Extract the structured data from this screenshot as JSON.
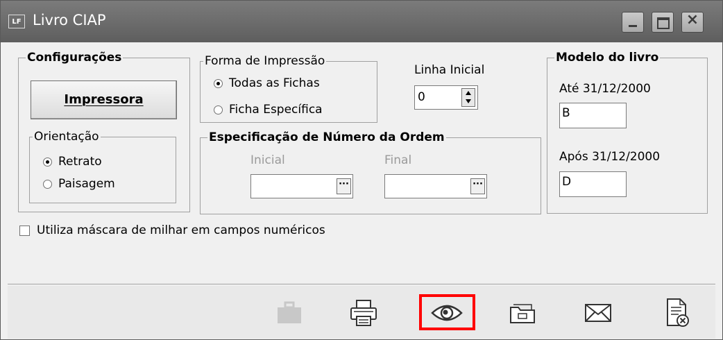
{
  "window": {
    "icon_text": "LF",
    "title": "Livro CIAP"
  },
  "configuracoes": {
    "legend": "Configurações",
    "printer_button": "Impressora",
    "orientacao": {
      "legend": "Orientação",
      "options": [
        "Retrato",
        "Paisagem"
      ],
      "selected": "Retrato"
    }
  },
  "forma_impressao": {
    "legend": "Forma de Impressão",
    "options": [
      "Todas as Fichas",
      "Ficha Específica"
    ],
    "selected": "Todas as Fichas"
  },
  "linha_inicial": {
    "label": "Linha Inicial",
    "value": "0"
  },
  "especificacao": {
    "legend": "Especificação de Número da Ordem",
    "inicial_label": "Inicial",
    "inicial_value": "",
    "final_label": "Final",
    "final_value": ""
  },
  "modelo_livro": {
    "legend": "Modelo do livro",
    "ate_label": "Até 31/12/2000",
    "ate_value": "B",
    "apos_label": "Após 31/12/2000",
    "apos_value": "D"
  },
  "mascara_checkbox": {
    "label": "Utiliza máscara de milhar em campos numéricos",
    "checked": false
  },
  "toolbar": {
    "tools": [
      {
        "icon": "briefcase-icon",
        "enabled": false
      },
      {
        "icon": "printer-icon",
        "enabled": true
      },
      {
        "icon": "eye-icon",
        "enabled": true,
        "highlighted": true
      },
      {
        "icon": "folder-icon",
        "enabled": true
      },
      {
        "icon": "envelope-icon",
        "enabled": true
      },
      {
        "icon": "document-close-icon",
        "enabled": true
      }
    ]
  },
  "colors": {
    "highlight": "#ff0000",
    "titlebar": "#6b6b6b",
    "disabled_label": "#9a9a9a"
  }
}
